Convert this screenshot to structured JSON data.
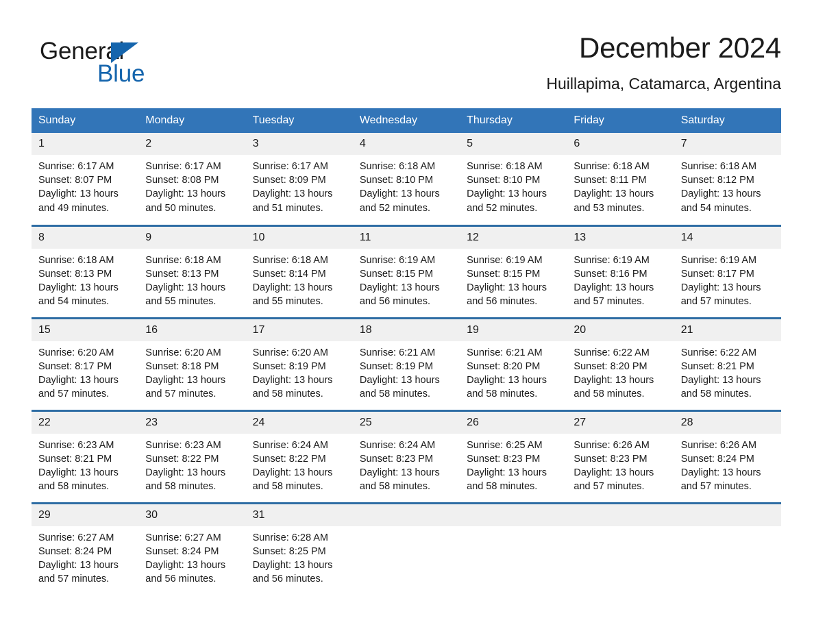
{
  "brand": {
    "name_part1": "General",
    "name_part2": "Blue",
    "triangle_icon": "triangle-icon",
    "accent_color": "#1565ad"
  },
  "header": {
    "month_title": "December 2024",
    "location": "Huillapima, Catamarca, Argentina"
  },
  "theme": {
    "header_blue": "#3275b8",
    "row_border_blue": "#2e6da4",
    "daynum_band": "#f0f0f0",
    "text": "#1b1b1b"
  },
  "calendar": {
    "weekday_headers": [
      "Sunday",
      "Monday",
      "Tuesday",
      "Wednesday",
      "Thursday",
      "Friday",
      "Saturday"
    ],
    "weeks": [
      [
        {
          "day": "1",
          "sunrise": "Sunrise: 6:17 AM",
          "sunset": "Sunset: 8:07 PM",
          "daylight": "Daylight: 13 hours and 49 minutes."
        },
        {
          "day": "2",
          "sunrise": "Sunrise: 6:17 AM",
          "sunset": "Sunset: 8:08 PM",
          "daylight": "Daylight: 13 hours and 50 minutes."
        },
        {
          "day": "3",
          "sunrise": "Sunrise: 6:17 AM",
          "sunset": "Sunset: 8:09 PM",
          "daylight": "Daylight: 13 hours and 51 minutes."
        },
        {
          "day": "4",
          "sunrise": "Sunrise: 6:18 AM",
          "sunset": "Sunset: 8:10 PM",
          "daylight": "Daylight: 13 hours and 52 minutes."
        },
        {
          "day": "5",
          "sunrise": "Sunrise: 6:18 AM",
          "sunset": "Sunset: 8:10 PM",
          "daylight": "Daylight: 13 hours and 52 minutes."
        },
        {
          "day": "6",
          "sunrise": "Sunrise: 6:18 AM",
          "sunset": "Sunset: 8:11 PM",
          "daylight": "Daylight: 13 hours and 53 minutes."
        },
        {
          "day": "7",
          "sunrise": "Sunrise: 6:18 AM",
          "sunset": "Sunset: 8:12 PM",
          "daylight": "Daylight: 13 hours and 54 minutes."
        }
      ],
      [
        {
          "day": "8",
          "sunrise": "Sunrise: 6:18 AM",
          "sunset": "Sunset: 8:13 PM",
          "daylight": "Daylight: 13 hours and 54 minutes."
        },
        {
          "day": "9",
          "sunrise": "Sunrise: 6:18 AM",
          "sunset": "Sunset: 8:13 PM",
          "daylight": "Daylight: 13 hours and 55 minutes."
        },
        {
          "day": "10",
          "sunrise": "Sunrise: 6:18 AM",
          "sunset": "Sunset: 8:14 PM",
          "daylight": "Daylight: 13 hours and 55 minutes."
        },
        {
          "day": "11",
          "sunrise": "Sunrise: 6:19 AM",
          "sunset": "Sunset: 8:15 PM",
          "daylight": "Daylight: 13 hours and 56 minutes."
        },
        {
          "day": "12",
          "sunrise": "Sunrise: 6:19 AM",
          "sunset": "Sunset: 8:15 PM",
          "daylight": "Daylight: 13 hours and 56 minutes."
        },
        {
          "day": "13",
          "sunrise": "Sunrise: 6:19 AM",
          "sunset": "Sunset: 8:16 PM",
          "daylight": "Daylight: 13 hours and 57 minutes."
        },
        {
          "day": "14",
          "sunrise": "Sunrise: 6:19 AM",
          "sunset": "Sunset: 8:17 PM",
          "daylight": "Daylight: 13 hours and 57 minutes."
        }
      ],
      [
        {
          "day": "15",
          "sunrise": "Sunrise: 6:20 AM",
          "sunset": "Sunset: 8:17 PM",
          "daylight": "Daylight: 13 hours and 57 minutes."
        },
        {
          "day": "16",
          "sunrise": "Sunrise: 6:20 AM",
          "sunset": "Sunset: 8:18 PM",
          "daylight": "Daylight: 13 hours and 57 minutes."
        },
        {
          "day": "17",
          "sunrise": "Sunrise: 6:20 AM",
          "sunset": "Sunset: 8:19 PM",
          "daylight": "Daylight: 13 hours and 58 minutes."
        },
        {
          "day": "18",
          "sunrise": "Sunrise: 6:21 AM",
          "sunset": "Sunset: 8:19 PM",
          "daylight": "Daylight: 13 hours and 58 minutes."
        },
        {
          "day": "19",
          "sunrise": "Sunrise: 6:21 AM",
          "sunset": "Sunset: 8:20 PM",
          "daylight": "Daylight: 13 hours and 58 minutes."
        },
        {
          "day": "20",
          "sunrise": "Sunrise: 6:22 AM",
          "sunset": "Sunset: 8:20 PM",
          "daylight": "Daylight: 13 hours and 58 minutes."
        },
        {
          "day": "21",
          "sunrise": "Sunrise: 6:22 AM",
          "sunset": "Sunset: 8:21 PM",
          "daylight": "Daylight: 13 hours and 58 minutes."
        }
      ],
      [
        {
          "day": "22",
          "sunrise": "Sunrise: 6:23 AM",
          "sunset": "Sunset: 8:21 PM",
          "daylight": "Daylight: 13 hours and 58 minutes."
        },
        {
          "day": "23",
          "sunrise": "Sunrise: 6:23 AM",
          "sunset": "Sunset: 8:22 PM",
          "daylight": "Daylight: 13 hours and 58 minutes."
        },
        {
          "day": "24",
          "sunrise": "Sunrise: 6:24 AM",
          "sunset": "Sunset: 8:22 PM",
          "daylight": "Daylight: 13 hours and 58 minutes."
        },
        {
          "day": "25",
          "sunrise": "Sunrise: 6:24 AM",
          "sunset": "Sunset: 8:23 PM",
          "daylight": "Daylight: 13 hours and 58 minutes."
        },
        {
          "day": "26",
          "sunrise": "Sunrise: 6:25 AM",
          "sunset": "Sunset: 8:23 PM",
          "daylight": "Daylight: 13 hours and 58 minutes."
        },
        {
          "day": "27",
          "sunrise": "Sunrise: 6:26 AM",
          "sunset": "Sunset: 8:23 PM",
          "daylight": "Daylight: 13 hours and 57 minutes."
        },
        {
          "day": "28",
          "sunrise": "Sunrise: 6:26 AM",
          "sunset": "Sunset: 8:24 PM",
          "daylight": "Daylight: 13 hours and 57 minutes."
        }
      ],
      [
        {
          "day": "29",
          "sunrise": "Sunrise: 6:27 AM",
          "sunset": "Sunset: 8:24 PM",
          "daylight": "Daylight: 13 hours and 57 minutes."
        },
        {
          "day": "30",
          "sunrise": "Sunrise: 6:27 AM",
          "sunset": "Sunset: 8:24 PM",
          "daylight": "Daylight: 13 hours and 56 minutes."
        },
        {
          "day": "31",
          "sunrise": "Sunrise: 6:28 AM",
          "sunset": "Sunset: 8:25 PM",
          "daylight": "Daylight: 13 hours and 56 minutes."
        },
        {
          "day": "",
          "sunrise": "",
          "sunset": "",
          "daylight": ""
        },
        {
          "day": "",
          "sunrise": "",
          "sunset": "",
          "daylight": ""
        },
        {
          "day": "",
          "sunrise": "",
          "sunset": "",
          "daylight": ""
        },
        {
          "day": "",
          "sunrise": "",
          "sunset": "",
          "daylight": ""
        }
      ]
    ]
  }
}
